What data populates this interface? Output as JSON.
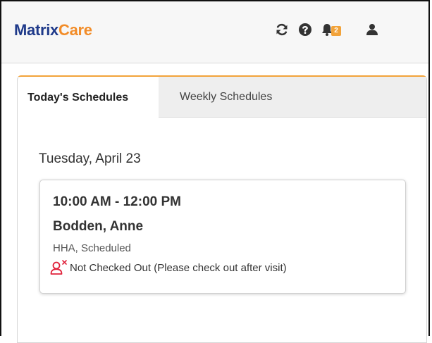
{
  "header": {
    "logo_part1": "Matrix",
    "logo_part2": "Care",
    "notification_count": "2",
    "icons": [
      "refresh-icon",
      "help-icon",
      "bell-icon",
      "user-icon"
    ],
    "colors": {
      "brand_blue": "#1f3a8a",
      "brand_orange": "#f28c28",
      "badge": "#f2a33a",
      "alert_red": "#e0223b"
    }
  },
  "tabs": [
    {
      "label": "Today's Schedules",
      "active": true
    },
    {
      "label": "Weekly Schedules",
      "active": false
    }
  ],
  "schedule": {
    "date": "Tuesday, April 23",
    "visit": {
      "time": "10:00 AM - 12:00 PM",
      "client": "Bodden, Anne",
      "role_status": "HHA, Scheduled",
      "checkout_status": "Not Checked Out (Please check out after visit)",
      "status_icon": "user-x-icon"
    }
  }
}
